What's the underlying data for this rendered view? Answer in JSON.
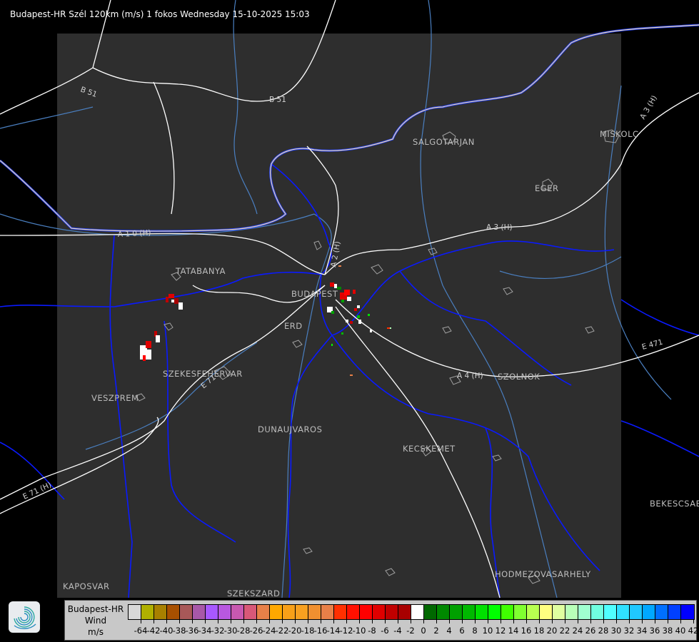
{
  "title": "Budapest-HR Szél 120km (m/s) 1 fokos Wednesday 15-10-2025 15:03",
  "map": {
    "cities": [
      "SALGOTARJAN",
      "EGER",
      "MISKOLC",
      "TATABANYA",
      "BUDAPEST",
      "ERD",
      "SZEKESFEHERVAR",
      "VESZPREM",
      "DUNAUJVAROS",
      "KECSKEMET",
      "SZOLNOK",
      "BEKESCSABA",
      "HODMEZOVASARHELY",
      "KAPOSVAR",
      "SZEKSZARD"
    ],
    "roads": [
      "B 51",
      "B 51",
      "A 3 (H)",
      "A 3 (H)",
      "A 1 0 (H)",
      "A 2 (H)",
      "A 4 (H)",
      "E 471",
      "E 71 (H)",
      "E 71"
    ],
    "colors": {
      "background": "#000000",
      "coverage": "#2e2e2e",
      "roads": "#ffffff",
      "county_borders": "#0a1aff",
      "rivers": "#4a7fc0",
      "country_border": "#f0d8a8",
      "town_outlines": "#a0a0a0"
    }
  },
  "legend": {
    "name_line1": "Budapest-HR",
    "name_line2": "Wind",
    "unit": "m/s",
    "tick_labels": [
      "-64",
      "-42",
      "-40",
      "-38",
      "-36",
      "-34",
      "-32",
      "-30",
      "-28",
      "-26",
      "-24",
      "-22",
      "-20",
      "-18",
      "-16",
      "-14",
      "-12",
      "-10",
      "-8",
      "-6",
      "-4",
      "-2",
      "0",
      "2",
      "4",
      "6",
      "8",
      "10",
      "12",
      "14",
      "16",
      "18",
      "20",
      "22",
      "24",
      "26",
      "28",
      "30",
      "32",
      "34",
      "36",
      "38",
      "40",
      "42"
    ],
    "colors": [
      "#d8d8d8",
      "#b0b000",
      "#a88000",
      "#a85000",
      "#a85858",
      "#a858a8",
      "#a858ff",
      "#b858e0",
      "#c858b0",
      "#d85878",
      "#e88048",
      "#ffa800",
      "#f8a018",
      "#f8a020",
      "#f09030",
      "#e88048",
      "#ff3000",
      "#ff1000",
      "#ff0000",
      "#e00000",
      "#c00000",
      "#a80000",
      "#ffffff",
      "#006800",
      "#008800",
      "#00a000",
      "#00b800",
      "#00e000",
      "#00ff00",
      "#40ff00",
      "#80ff30",
      "#b8ff50",
      "#ffff80",
      "#e0ffa0",
      "#b8ffb8",
      "#a0ffd0",
      "#70ffe0",
      "#50ffff",
      "#30e0ff",
      "#20c8ff",
      "#00a8ff",
      "#0070ff",
      "#0040ff",
      "#0000ff"
    ]
  },
  "logo": {
    "icon": "swirl-logo-icon"
  }
}
